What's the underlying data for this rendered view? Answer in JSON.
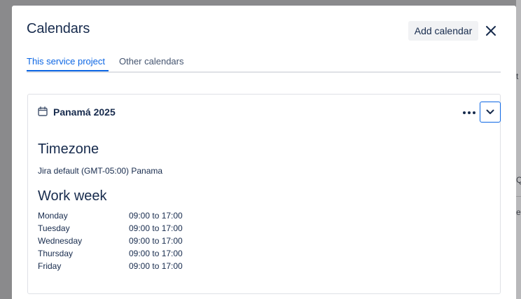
{
  "modal": {
    "title": "Calendars",
    "add_calendar_label": "Add calendar",
    "close_icon": "close-icon"
  },
  "tabs": [
    {
      "label": "This service project",
      "active": true
    },
    {
      "label": "Other calendars",
      "active": false
    }
  ],
  "calendar": {
    "name": "Panamá 2025",
    "icon": "calendar-icon",
    "more_icon": "more-horizontal-icon",
    "expand_icon": "chevron-down-icon",
    "timezone_heading": "Timezone",
    "timezone_value": "Jira default (GMT-05:00) Panama",
    "work_week_heading": "Work week",
    "work_week": [
      {
        "day": "Monday",
        "hours": "09:00 to 17:00"
      },
      {
        "day": "Tuesday",
        "hours": "09:00 to 17:00"
      },
      {
        "day": "Wednesday",
        "hours": "09:00 to 17:00"
      },
      {
        "day": "Thursday",
        "hours": "09:00 to 17:00"
      },
      {
        "day": "Friday",
        "hours": "09:00 to 17:00"
      }
    ]
  },
  "background_fragments": [
    "t",
    "Q",
    "e"
  ],
  "colors": {
    "accent": "#0c66e4",
    "text": "#172b4d",
    "subtle_text": "#44546f",
    "border": "#dfe1e6",
    "button_bg": "#f1f2f4",
    "overlay": "#8a8a8c"
  }
}
